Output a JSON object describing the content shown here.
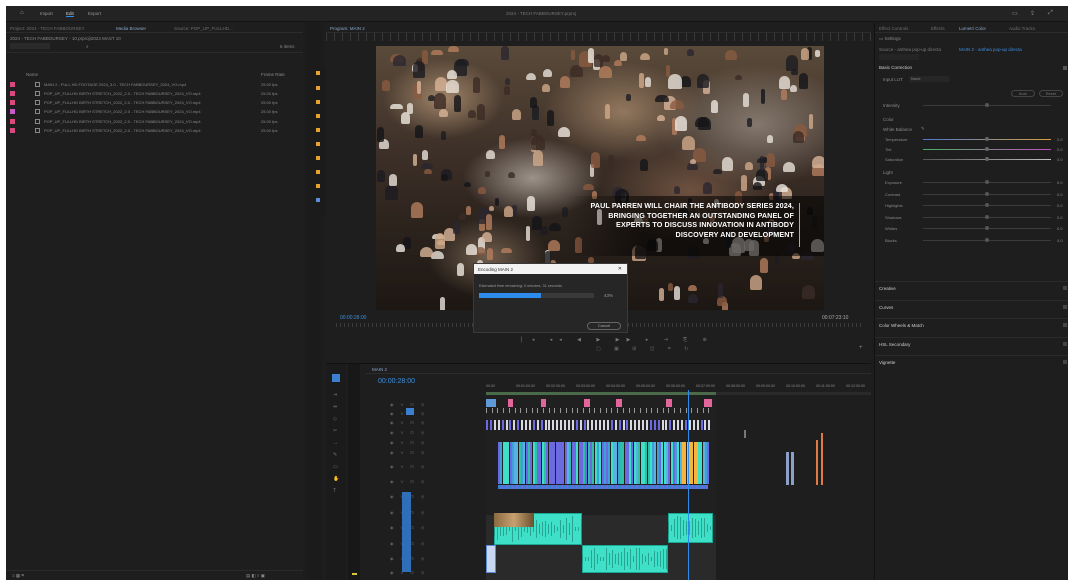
{
  "topbar": {
    "tabs": [
      "Import",
      "Edit",
      "Export"
    ],
    "title": "2024 - TECH FABBOURSEY.prproj"
  },
  "project_panel": {
    "tabs": [
      "Project: 2024 - TECH FABBOURSEY",
      "Media Browser",
      "Source: POP_UP_FULLHD..."
    ],
    "path": "2024 - TECH FABBOURSEY - 10.prproj\\2024 MAST 10",
    "count": "6 items",
    "col_name": "Name",
    "col_fps": "Frame Rate",
    "items": [
      {
        "name": "MAIN 2 - FULL HD FOOTAGE 2024_3.0 - TECH FABBOURSEY_2024_VO.mp4",
        "fps": "25.00 fps",
        "color": "#d9497d"
      },
      {
        "name": "POP_UP_FULLHD BIRTH STRETCH_2022_2.0 - TECH FABBOURSEY_2024_VO.mp4",
        "fps": "25.00 fps",
        "color": "#d9497d"
      },
      {
        "name": "POP_UP_FULLHD BIRTH STRETCH_2022_2.0 - TECH FABBOURSEY_2024_VO.mp4",
        "fps": "25.00 fps",
        "color": "#d9497d"
      },
      {
        "name": "POP_UP_FULLHD BIRTH STRETCH_2022_2.0 - TECH FABBOURSEY_2024_VO.mp4",
        "fps": "25.00 fps",
        "color": "#c85ac8"
      },
      {
        "name": "POP_UP_FULLHD BIRTH STRETCH_2022_2.0 - TECH FABBOURSEY_2024_VO.mp4",
        "fps": "25.00 fps",
        "color": "#d9497d"
      },
      {
        "name": "POP_UP_FULLHD BIRTH STRETCH_2022_2.0 - TECH FABBOURSEY_2024_VO.mp4",
        "fps": "25.00 fps",
        "color": "#d9497d"
      }
    ]
  },
  "program": {
    "tab": "Program: MAIN 2",
    "caption": [
      "PAUL PARREN WILL CHAIR THE ANTIBODY SERIES 2024,",
      "BRINGING TOGETHER AN OUTSTANDING PANEL OF",
      "EXPERTS TO DISCUSS INNOVATION IN ANTIBODY",
      "DISCOVERY AND DEVELOPMENT"
    ],
    "timecode_left": "00:00:28:00",
    "timecode_right": "00:07:23:10",
    "fit": "Fit"
  },
  "dialog": {
    "title": "Encoding MAIN 2",
    "eta": "Estimated time remaining: 0 minutes, 31 seconds",
    "percent": "43%",
    "progress": 0.43,
    "cancel": "Cancel"
  },
  "timeline": {
    "tab": "MAIN 2",
    "timecode": "00:00:28:00",
    "ruler": [
      "00:00",
      "00:01:00:00",
      "00:02:00:00",
      "00:03:00:00",
      "00:04:00:00",
      "00:05:00:00",
      "00:06:00:00",
      "00:07:00:00",
      "00:08:00:00",
      "00:09:00:00",
      "00:10:00:00",
      "00:11:00:00",
      "00:12:00:00"
    ]
  },
  "lumetri": {
    "tabs": [
      "Effect Controls",
      "Effects",
      "Lumetri Color",
      "Audio Tracks"
    ],
    "subtab": "Settings",
    "source": "Source - anthea pop-up directa",
    "source_link": "MAIN 2 - anthea pop-up directa",
    "basic": "Basic Correction",
    "input_lut": "Input LUT",
    "input_lut_val": "None",
    "auto": "Auto",
    "reset": "Reset",
    "intensity": "Intensity",
    "color": "Color",
    "wb": "White Balance",
    "sliders_color": [
      "Temperature",
      "Tint",
      "Saturation"
    ],
    "light": "Light",
    "sliders_light": [
      "Exposure",
      "Contrast",
      "Highlights",
      "Shadows",
      "Whites",
      "Blacks"
    ],
    "sections": [
      "Creative",
      "Curves",
      "Color Wheels & Match",
      "HSL Secondary",
      "Vignette"
    ]
  },
  "colors": {
    "accent": "#2d8ceb",
    "teal": "#3ee0c8",
    "pink": "#e2669a",
    "purple": "#6c6ae0"
  }
}
